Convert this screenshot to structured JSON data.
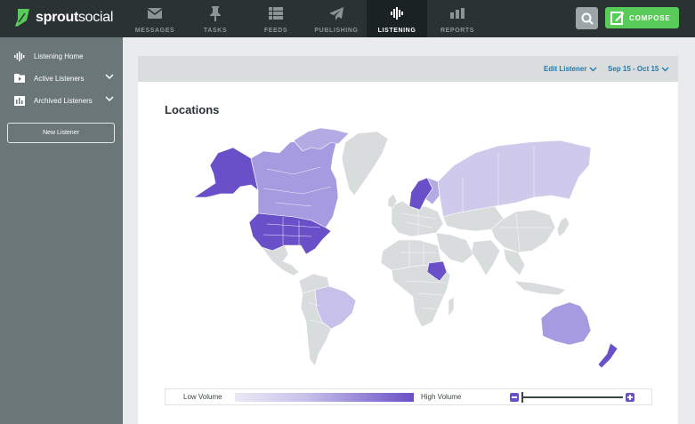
{
  "brand": {
    "name_bold": "sprout",
    "name_light": "social",
    "accent": "#59cb59"
  },
  "nav": {
    "items": [
      {
        "label": "MESSAGES",
        "icon": "envelope-icon"
      },
      {
        "label": "TASKS",
        "icon": "pin-icon"
      },
      {
        "label": "FEEDS",
        "icon": "list-icon"
      },
      {
        "label": "PUBLISHING",
        "icon": "paper-plane-icon"
      },
      {
        "label": "LISTENING",
        "icon": "waveform-icon",
        "active": true
      },
      {
        "label": "REPORTS",
        "icon": "bar-chart-icon"
      }
    ]
  },
  "toolbar": {
    "compose_label": "COMPOSE"
  },
  "sidebar": {
    "items": [
      {
        "label": "Listening Home",
        "icon": "waveform-icon"
      },
      {
        "label": "Active Listeners",
        "icon": "folder-play-icon",
        "expandable": true
      },
      {
        "label": "Archived Listeners",
        "icon": "archive-icon",
        "expandable": true
      }
    ],
    "new_listener_label": "New Listener"
  },
  "panel": {
    "edit_listener_label": "Edit Listener",
    "date_range_label": "Sep 15 - Oct 15",
    "title": "Locations"
  },
  "legend": {
    "low_label": "Low Volume",
    "high_label": "High Volume",
    "low_color": "#ebe9f5",
    "high_color": "#6a50c8"
  },
  "colors": {
    "topbar": "#2a3233",
    "sidebar": "#6a7677",
    "link": "#2479a8",
    "map_base": "#d9dcdd"
  }
}
